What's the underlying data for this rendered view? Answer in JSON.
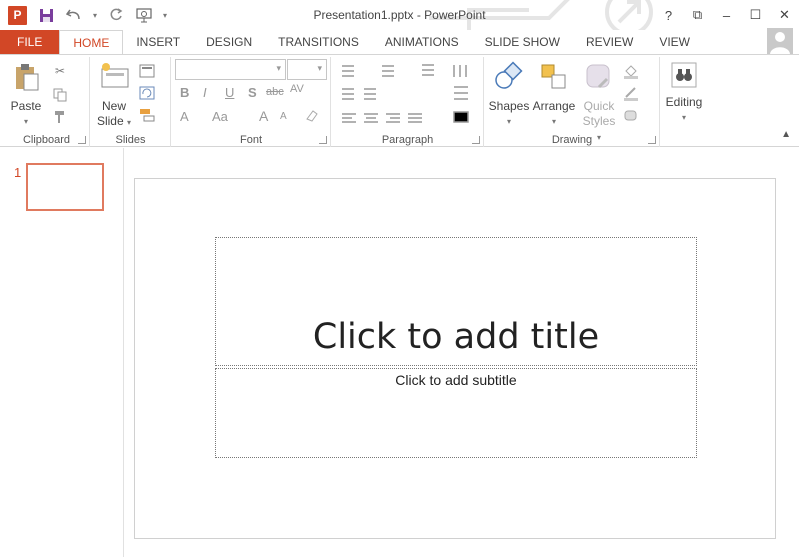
{
  "window": {
    "title": "Presentation1.pptx - PowerPoint",
    "app_icon_letter": "P",
    "controls": {
      "help": "?",
      "ribbon_display": "⧉",
      "minimize": "–",
      "maximize": "☐",
      "close": "✕"
    }
  },
  "qat": {
    "customize": "▾"
  },
  "tabs": [
    {
      "label": "FILE"
    },
    {
      "label": "HOME"
    },
    {
      "label": "INSERT"
    },
    {
      "label": "DESIGN"
    },
    {
      "label": "TRANSITIONS"
    },
    {
      "label": "ANIMATIONS"
    },
    {
      "label": "SLIDE SHOW"
    },
    {
      "label": "REVIEW"
    },
    {
      "label": "VIEW"
    }
  ],
  "ribbon": {
    "clipboard": {
      "label": "Clipboard",
      "paste": "Paste"
    },
    "slides": {
      "label": "Slides",
      "new_slide_1": "New",
      "new_slide_2": "Slide"
    },
    "font": {
      "label": "Font",
      "bold": "B",
      "italic": "I",
      "underline": "U",
      "shadow": "S",
      "strike": "abc",
      "spacing": "AV",
      "case": "Aa",
      "grow": "A",
      "shrink": "A",
      "color": "A"
    },
    "paragraph": {
      "label": "Paragraph"
    },
    "drawing": {
      "label": "Drawing",
      "shapes": "Shapes",
      "arrange": "Arrange",
      "quick_1": "Quick",
      "quick_2": "Styles"
    },
    "editing": {
      "label": "Editing"
    }
  },
  "thumbnails": [
    {
      "number": "1"
    }
  ],
  "slide": {
    "title_placeholder": "Click to add title",
    "subtitle_placeholder": "Click to add subtitle"
  },
  "colors": {
    "accent": "#d24726",
    "thumb_border": "#e07a5f"
  }
}
